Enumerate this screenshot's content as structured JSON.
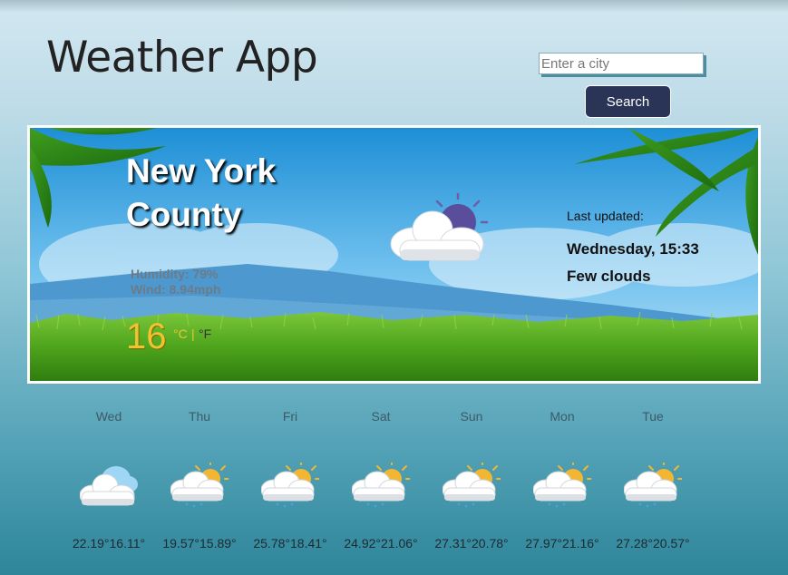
{
  "app": {
    "title": "Weather App"
  },
  "search": {
    "placeholder": "Enter a city",
    "button_label": "Search"
  },
  "current": {
    "city": "New York County",
    "humidity": "Humidity: 79%",
    "wind": "Wind: 8.94mph",
    "temperature": "16",
    "unit_celsius": "°C",
    "unit_separator": "|",
    "unit_fahrenheit": "°F",
    "last_updated_label": "Last updated:",
    "last_updated": "Wednesday, 15:33",
    "condition": "Few clouds",
    "icon": "few-clouds-icon"
  },
  "forecast": [
    {
      "day": "Wed",
      "temps": "22.19°16.11°",
      "icon": "cloud-icon"
    },
    {
      "day": "Thu",
      "temps": "19.57°15.89°",
      "icon": "sun-cloud-rain-icon"
    },
    {
      "day": "Fri",
      "temps": "25.78°18.41°",
      "icon": "sun-cloud-rain-icon"
    },
    {
      "day": "Sat",
      "temps": "24.92°21.06°",
      "icon": "sun-cloud-rain-icon"
    },
    {
      "day": "Sun",
      "temps": "27.31°20.78°",
      "icon": "sun-cloud-rain-icon"
    },
    {
      "day": "Mon",
      "temps": "27.97°21.16°",
      "icon": "sun-cloud-rain-icon"
    },
    {
      "day": "Tue",
      "temps": "27.28°20.57°",
      "icon": "sun-cloud-rain-icon"
    }
  ],
  "colors": {
    "search_button": "#2a3457",
    "temperature": "#f1c232",
    "sky": "#2a97d8",
    "grass": "#5fb41f"
  }
}
